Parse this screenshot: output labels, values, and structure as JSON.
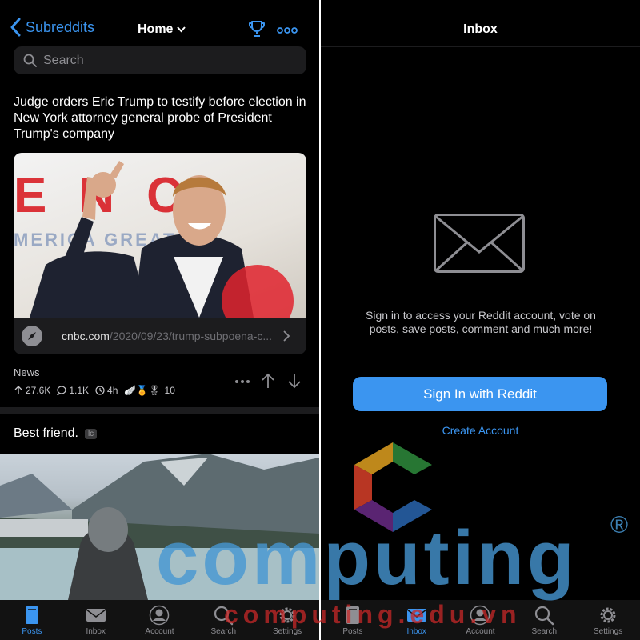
{
  "left": {
    "header": {
      "back_label": "Subreddits",
      "title": "Home"
    },
    "search": {
      "placeholder": "Search"
    },
    "post1": {
      "title": "Judge orders Eric Trump to testify before election in New York attorney general probe of President Trump's company",
      "image_text": "ENC",
      "image_banner": "MERICA GREAT AG",
      "link_domain": "cnbc.com",
      "link_path": "/2020/09/23/trump-subpoena-c...",
      "subreddit": "News",
      "upvotes": "27.6K",
      "comments": "1.1K",
      "age": "4h",
      "awards": "10"
    },
    "post2": {
      "title": "Best friend.",
      "badge": "lc"
    },
    "tabs": [
      {
        "label": "Posts",
        "icon": "posts-icon"
      },
      {
        "label": "Inbox",
        "icon": "mail-icon"
      },
      {
        "label": "Account",
        "icon": "account-icon"
      },
      {
        "label": "Search",
        "icon": "search-icon"
      },
      {
        "label": "Settings",
        "icon": "gear-icon"
      }
    ]
  },
  "right": {
    "title": "Inbox",
    "message": "Sign in to access your Reddit account, vote on posts, save posts, comment and much more!",
    "signin_label": "Sign In with Reddit",
    "create_label": "Create Account",
    "tabs": [
      {
        "label": "Posts",
        "icon": "posts-icon"
      },
      {
        "label": "Inbox",
        "icon": "mail-icon"
      },
      {
        "label": "Account",
        "icon": "account-icon"
      },
      {
        "label": "Search",
        "icon": "search-icon"
      },
      {
        "label": "Settings",
        "icon": "gear-icon"
      }
    ]
  },
  "watermark": {
    "brand": "computing",
    "url": "computing.edu.vn",
    "reg": "®"
  },
  "colors": {
    "accent": "#3b95f0",
    "background": "#000000",
    "surface": "#1c1c1e"
  }
}
